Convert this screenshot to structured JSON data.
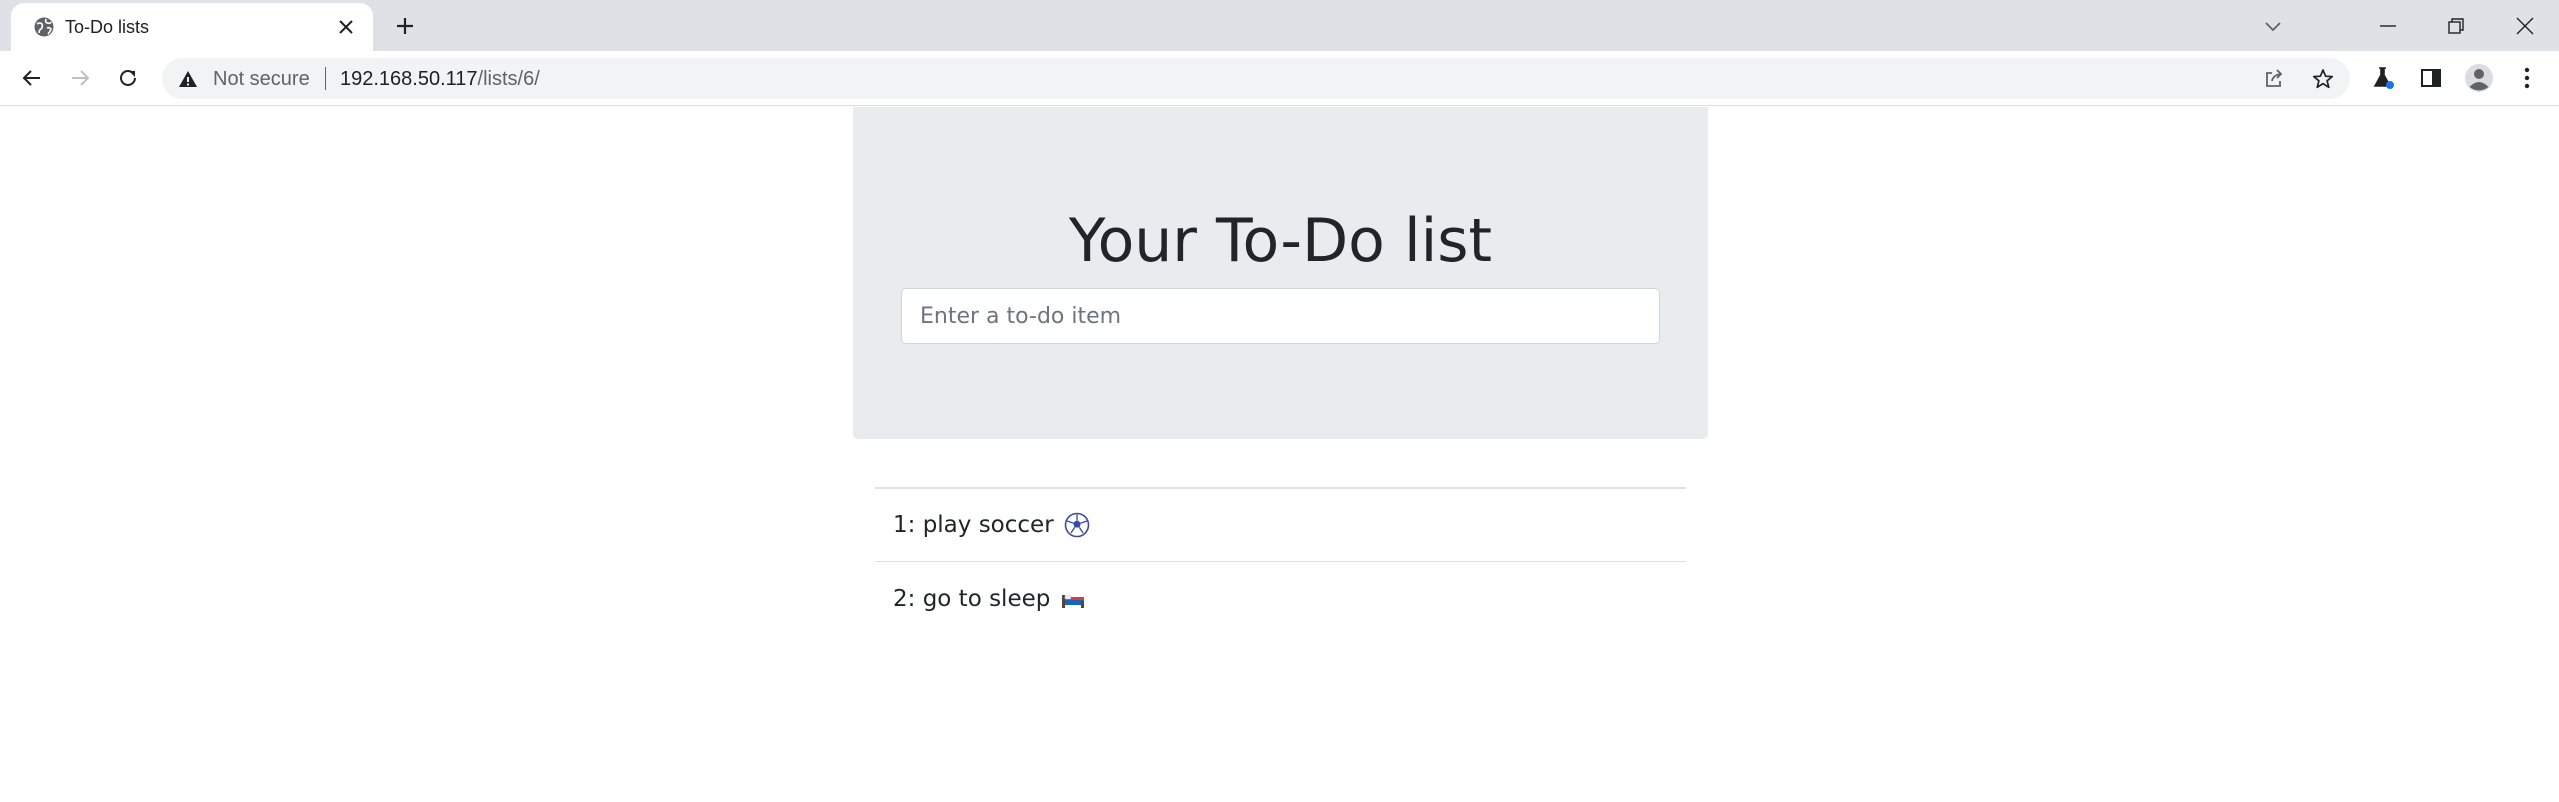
{
  "browser": {
    "tab": {
      "title": "To-Do lists"
    },
    "address": {
      "security_label": "Not secure",
      "url_host": "192.168.50.117",
      "url_path": "/lists/6/"
    },
    "icons": {
      "favicon": "globe-icon",
      "tab_close": "close-icon",
      "new_tab": "plus-icon",
      "tab_search": "chevron-down-icon",
      "minimize": "minimize-icon",
      "restore": "restore-icon",
      "close_window": "close-icon",
      "back": "arrow-left-icon",
      "forward": "arrow-right-icon",
      "reload": "reload-icon",
      "security": "warning-icon",
      "share": "share-icon",
      "bookmark": "star-icon",
      "labs": "flask-icon",
      "side_panel": "side-panel-icon",
      "profile": "profile-icon",
      "menu": "more-vertical-icon"
    }
  },
  "page": {
    "heading": "Your To-Do list",
    "input": {
      "placeholder": "Enter a to-do item",
      "value": ""
    },
    "items": [
      {
        "text": "1: play soccer",
        "emoji": "soccer-ball-icon"
      },
      {
        "text": "2: go to sleep",
        "emoji": "bed-icon"
      }
    ]
  },
  "colors": {
    "jumbotron_bg": "#e9ecef",
    "text": "#212529",
    "tabbar_bg": "#dee1e6",
    "omnibox_bg": "#f1f3f4"
  }
}
